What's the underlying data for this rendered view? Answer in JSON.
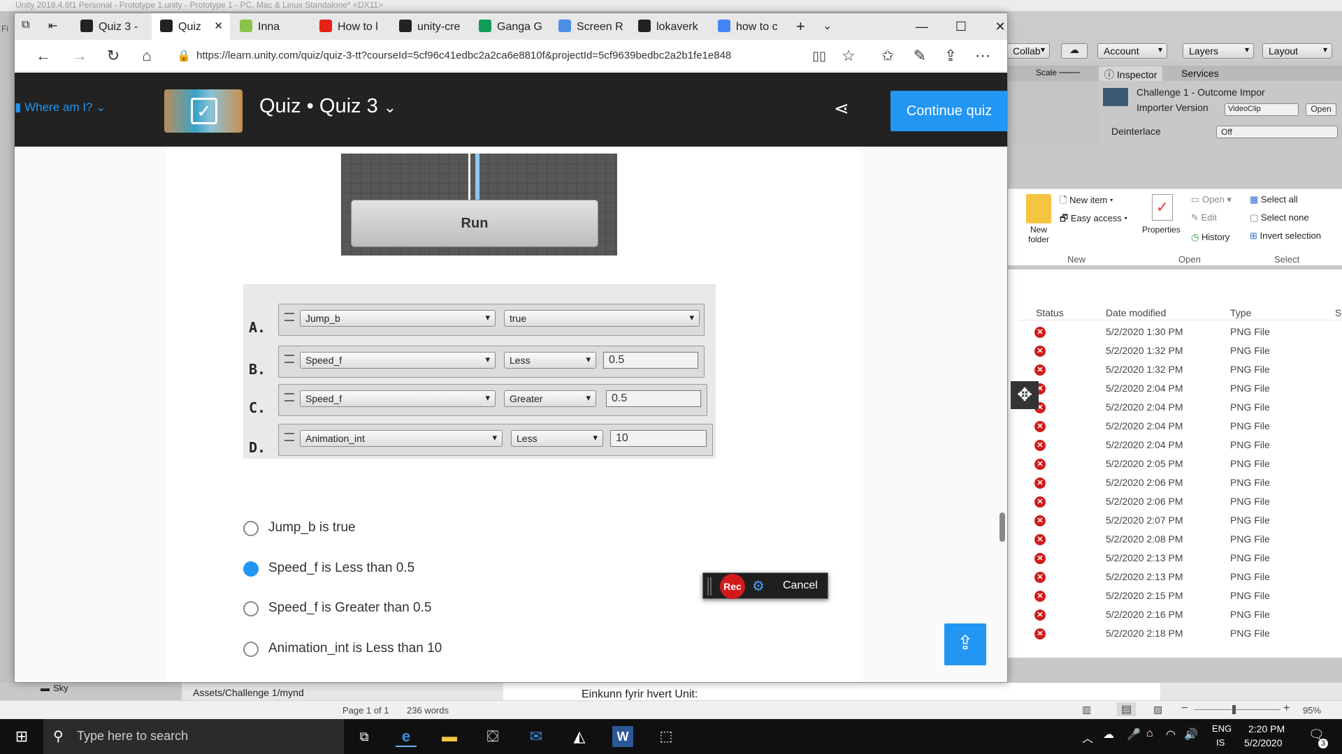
{
  "unity": {
    "title": "Unity 2018.4.6f1 Personal - Prototype 1.unity - Prototype 1 - PC, Mac & Linux Standalone* <DX11>",
    "menu_letter": "Fi",
    "toolbar": {
      "collab": "Collab",
      "account": "Account",
      "layers": "Layers",
      "layout": "Layout"
    },
    "tabs": {
      "inspector": "Inspector",
      "services": "Services",
      "scale": "Scale"
    },
    "inspector": {
      "asset_name": "Challenge 1 - Outcome Impor",
      "importer_version_label": "Importer Version",
      "importer_version_value": "VideoClip",
      "open_button": "Open",
      "deinterlace_label": "Deinterlace",
      "deinterlace_value": "Off"
    },
    "project": {
      "sky": "Sky",
      "assets_path": "Assets/Challenge 1/mynd"
    }
  },
  "explorer": {
    "ribbon": {
      "new_item": "New item",
      "easy_access": "Easy access",
      "new_folder": "New folder",
      "properties": "Properties",
      "open": "Open",
      "edit": "Edit",
      "history": "History",
      "select_all": "Select all",
      "select_none": "Select none",
      "invert_selection": "Invert selection",
      "group_new": "New",
      "group_open": "Open",
      "group_select": "Select"
    },
    "columns": {
      "status": "Status",
      "date_modified": "Date modified",
      "type": "Type",
      "size": "S"
    },
    "rows": [
      {
        "date": "5/2/2020 1:30 PM",
        "type": "PNG File"
      },
      {
        "date": "5/2/2020 1:32 PM",
        "type": "PNG File"
      },
      {
        "date": "5/2/2020 1:32 PM",
        "type": "PNG File"
      },
      {
        "date": "5/2/2020 2:04 PM",
        "type": "PNG File"
      },
      {
        "date": "5/2/2020 2:04 PM",
        "type": "PNG File"
      },
      {
        "date": "5/2/2020 2:04 PM",
        "type": "PNG File"
      },
      {
        "date": "5/2/2020 2:04 PM",
        "type": "PNG File"
      },
      {
        "date": "5/2/2020 2:05 PM",
        "type": "PNG File"
      },
      {
        "date": "5/2/2020 2:06 PM",
        "type": "PNG File"
      },
      {
        "date": "5/2/2020 2:06 PM",
        "type": "PNG File"
      },
      {
        "date": "5/2/2020 2:07 PM",
        "type": "PNG File"
      },
      {
        "date": "5/2/2020 2:08 PM",
        "type": "PNG File"
      },
      {
        "date": "5/2/2020 2:13 PM",
        "type": "PNG File"
      },
      {
        "date": "5/2/2020 2:13 PM",
        "type": "PNG File"
      },
      {
        "date": "5/2/2020 2:15 PM",
        "type": "PNG File"
      },
      {
        "date": "5/2/2020 2:16 PM",
        "type": "PNG File"
      },
      {
        "date": "5/2/2020 2:18 PM",
        "type": "PNG File"
      }
    ]
  },
  "word": {
    "doc_text": "Einkunn fyrir hvert Unit:",
    "page": "Page 1 of 1",
    "words": "236 words",
    "zoom": "95%"
  },
  "browser": {
    "tabs": [
      {
        "label": "Quiz 3 -",
        "icon": "unity-icon",
        "color": "#222222"
      },
      {
        "label": "Quiz",
        "icon": "unity-icon",
        "color": "#222222"
      },
      {
        "label": "Inna",
        "icon": "inna-icon",
        "color": "#8bc34a"
      },
      {
        "label": "How to l",
        "icon": "youtube-icon",
        "color": "#e62117"
      },
      {
        "label": "unity-cre",
        "icon": "github-icon",
        "color": "#222222"
      },
      {
        "label": "Ganga G",
        "icon": "sheets-icon",
        "color": "#0f9d58"
      },
      {
        "label": "Screen R",
        "icon": "screen-recorder-icon",
        "color": "#4a90e2"
      },
      {
        "label": "lokaverk",
        "icon": "github-icon",
        "color": "#222222"
      },
      {
        "label": "how to c",
        "icon": "google-icon",
        "color": "#4285f4"
      }
    ],
    "url": "https://learn.unity.com/quiz/quiz-3-tt?courseId=5cf96c41edbc2a2ca6e8810f&projectId=5cf9639bedbc2a2b1fe1e848"
  },
  "learn": {
    "where_am_i": "Where am I?",
    "title": "Quiz • Quiz 3",
    "continue_button": "Continue quiz",
    "animator_state": "Run",
    "conditions": [
      {
        "letter": "A.",
        "param": "Jump_b",
        "op": "true",
        "value": ""
      },
      {
        "letter": "B.",
        "param": "Speed_f",
        "op": "Less",
        "value": "0.5"
      },
      {
        "letter": "C.",
        "param": "Speed_f",
        "op": "Greater",
        "value": "0.5"
      },
      {
        "letter": "D.",
        "param": "Animation_int",
        "op": "Less",
        "value": "10"
      }
    ],
    "options": [
      {
        "label": "Jump_b is true",
        "selected": false
      },
      {
        "label": "Speed_f is Less than 0.5",
        "selected": true
      },
      {
        "label": "Speed_f is Greater than 0.5",
        "selected": false
      },
      {
        "label": "Animation_int is Less than 10",
        "selected": false
      }
    ]
  },
  "recorder": {
    "rec": "Rec",
    "cancel": "Cancel"
  },
  "taskbar": {
    "search_placeholder": "Type here to search",
    "lang_top": "ENG",
    "lang_bottom": "IS",
    "time": "2:20 PM",
    "date": "5/2/2020",
    "notifications": "3"
  },
  "colors": {
    "accent": "#2196f3",
    "header_bg": "#222222",
    "error_red": "#d01c1c"
  }
}
